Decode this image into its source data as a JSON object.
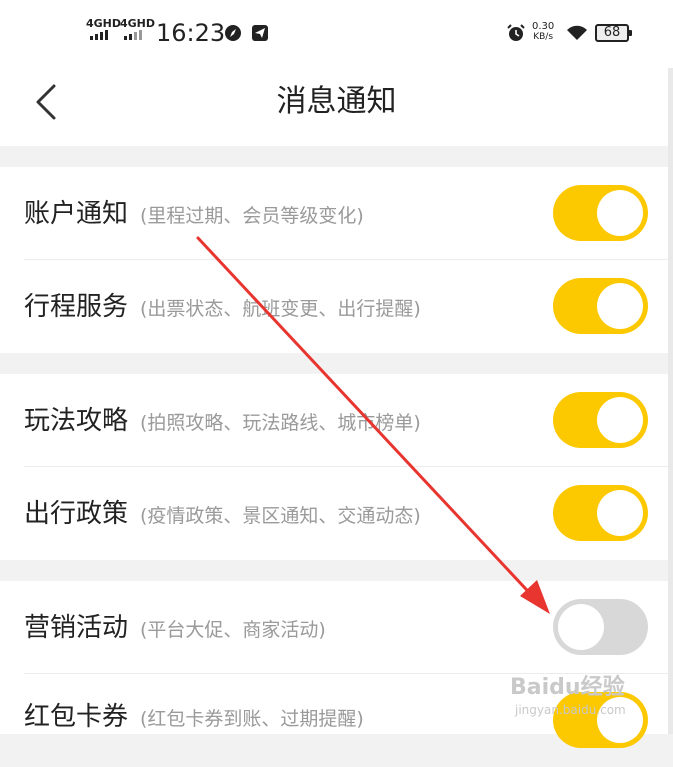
{
  "status_bar": {
    "sim1": "4GHD",
    "sim2": "4GHD",
    "time": "16:23",
    "speed_value": "0.30",
    "speed_unit": "KB/s",
    "battery": "68"
  },
  "header": {
    "title": "消息通知"
  },
  "settings": [
    {
      "title": "账户通知",
      "desc": "(里程过期、会员等级变化)",
      "enabled": true
    },
    {
      "title": "行程服务",
      "desc": "(出票状态、航班变更、出行提醒)",
      "enabled": true
    },
    {
      "title": "玩法攻略",
      "desc": "(拍照攻略、玩法路线、城市榜单)",
      "enabled": true
    },
    {
      "title": "出行政策",
      "desc": "(疫情政策、景区通知、交通动态)",
      "enabled": true
    },
    {
      "title": "营销活动",
      "desc": "(平台大促、商家活动)",
      "enabled": false
    },
    {
      "title": "红包卡券",
      "desc": "(红包卡券到账、过期提醒)",
      "enabled": true
    }
  ],
  "colors": {
    "toggle_on": "#fcc800",
    "toggle_off": "#d8d8d8",
    "annotation_arrow": "#e8352f"
  },
  "watermark": {
    "brand": "Baidu经验",
    "site": "jingyan.baidu.com"
  }
}
